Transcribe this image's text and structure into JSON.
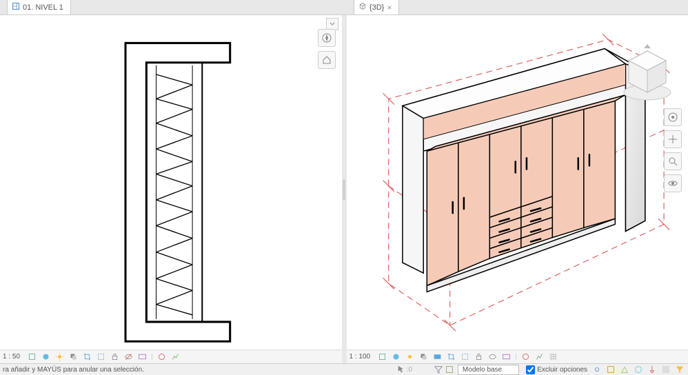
{
  "tabs": {
    "left_label": "01. NIVEL 1",
    "right_label": "{3D}"
  },
  "left_control": {
    "scale": "1 : 50"
  },
  "right_control": {
    "scale": "1 : 100"
  },
  "statusbar": {
    "hint": "ra añadir y MAYÚS para anular una selección.",
    "model_label": "Modelo base",
    "exclude_label": "Excluir opciones"
  },
  "icons": {
    "nav": [
      "compass-icon",
      "house-icon",
      "hand-icon",
      "zoom-icon",
      "orbit-icon"
    ],
    "vcb": [
      "box",
      "sun",
      "shadow",
      "crop",
      "frame",
      "frame2",
      "lock",
      "hide",
      "reveal",
      "sep",
      "filter",
      "path",
      "line"
    ],
    "sb_mid": [
      "select",
      "filter",
      "highlight",
      "templink",
      "thinline",
      "reveal",
      "join",
      "cut"
    ],
    "sb_right": [
      "warn",
      "filter2",
      "tree",
      "link",
      "cloud",
      "sync",
      "layers"
    ]
  },
  "colors": {
    "cabinet_fill": "#f5cbb8",
    "section_red": "#d66"
  }
}
